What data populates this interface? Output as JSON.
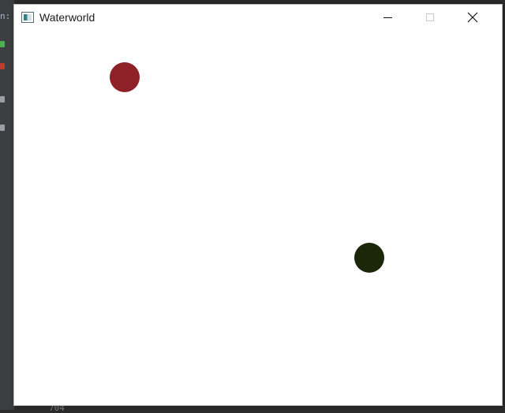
{
  "window": {
    "title": "Waterworld",
    "minimize_symbol": "",
    "close_symbol": "✕"
  },
  "ide": {
    "left_fragment": "n:",
    "bottom_fragment": "704"
  },
  "colors": {
    "ball_red": "#8e2027",
    "ball_dark": "#1c2608",
    "ide_icon_green": "#4caf50",
    "ide_icon_red": "#c0392b",
    "ide_icon_grey": "#9aa0a6"
  },
  "canvas": {
    "ball_count_visible": 2
  }
}
